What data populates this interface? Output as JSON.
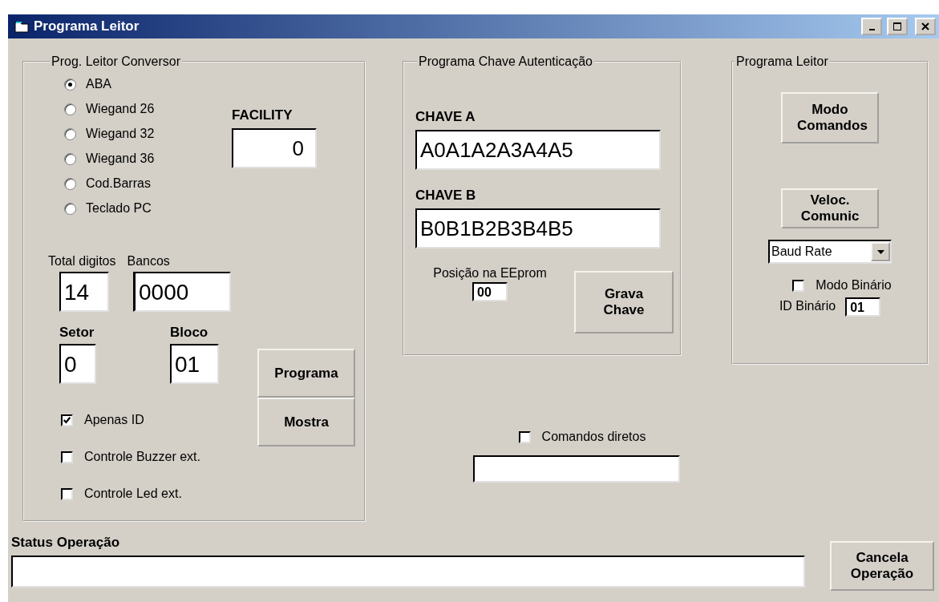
{
  "window": {
    "title": "Programa Leitor"
  },
  "converter": {
    "title": "Prog. Leitor Conversor",
    "formats": [
      {
        "label": "ABA",
        "selected": true
      },
      {
        "label": "Wiegand 26",
        "selected": false
      },
      {
        "label": "Wiegand 32",
        "selected": false
      },
      {
        "label": "Wiegand 36",
        "selected": false
      },
      {
        "label": "Cod.Barras",
        "selected": false
      },
      {
        "label": "Teclado PC",
        "selected": false
      }
    ],
    "facility": {
      "label": "FACILITY",
      "value": "0"
    },
    "total_digits": {
      "label": "Total digitos",
      "value": "14"
    },
    "banks": {
      "label": "Bancos",
      "value": "0000"
    },
    "sector": {
      "label": "Setor",
      "value": "0"
    },
    "block": {
      "label": "Bloco",
      "value": "01"
    },
    "buttons": [
      "Programa",
      "Mostra"
    ],
    "options": [
      {
        "label": "Apenas ID",
        "checked": true
      },
      {
        "label": "Controle Buzzer ext.",
        "checked": false
      },
      {
        "label": "Controle Led ext.",
        "checked": false
      }
    ]
  },
  "auth_key": {
    "title": "Programa Chave Autenticação",
    "key_a": {
      "label": "CHAVE A",
      "value": "A0A1A2A3A4A5"
    },
    "key_b": {
      "label": "CHAVE B",
      "value": "B0B1B2B3B4B5"
    },
    "eeprom": {
      "label": "Posição na EEprom",
      "value": "00"
    },
    "save_button": "Grava Chave"
  },
  "reader": {
    "title": "Programa Leitor",
    "command_mode_button": "Modo Comandos",
    "speed_button": "Veloc. Comunic",
    "baud_rate": {
      "value": "Baud Rate"
    },
    "binary_mode": {
      "label": "Modo Binário",
      "checked": false
    },
    "binary_id": {
      "label": "ID Binário",
      "value": "01"
    }
  },
  "direct_commands": {
    "label": "Comandos diretos",
    "checked": false
  },
  "status": {
    "label": "Status Operação"
  },
  "cancel_button": "Cancela Operação"
}
